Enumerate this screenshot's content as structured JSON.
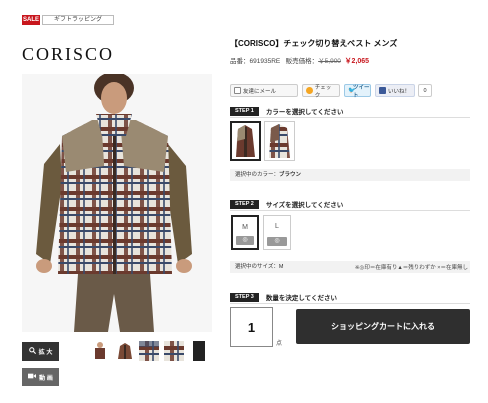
{
  "tags": {
    "sale": "SALE",
    "gift": "ギフトラッピング"
  },
  "brand": "CORISCO",
  "product": {
    "title": "【CORISCO】チェック切り替えベスト メンズ",
    "code_label": "品番：",
    "code": "691935RE",
    "price_label": "販売価格：",
    "original_price": "￥5,900",
    "sale_price": "￥2,065"
  },
  "social": {
    "mail": "友達にメール",
    "check": "チェック",
    "tweet": "ツイート",
    "like": "いいね！",
    "like_count": "0"
  },
  "step1": {
    "badge": "STEP 1",
    "label": "カラーを選択してください",
    "selected_prefix": "選択中のカラー：",
    "selected": "ブラウン"
  },
  "step2": {
    "badge": "STEP 2",
    "label": "サイズを選択してください",
    "sizes": [
      {
        "label": "M",
        "stock": "◎"
      },
      {
        "label": "L",
        "stock": "◎"
      }
    ],
    "selected_prefix": "選択中のサイズ：",
    "selected": "M",
    "legend": "※◎印＝在庫有り▲＝残りわずか ×＝在庫無し"
  },
  "step3": {
    "badge": "STEP 3",
    "label": "数量を決定してください",
    "quantity": "1",
    "unit": "点"
  },
  "cart_button": "ショッピングカートに入れる",
  "buttons": {
    "zoom": "拡 大",
    "video": "動 画"
  },
  "colors": {
    "sale_red": "#c8161d",
    "dark": "#2f2f2f"
  }
}
